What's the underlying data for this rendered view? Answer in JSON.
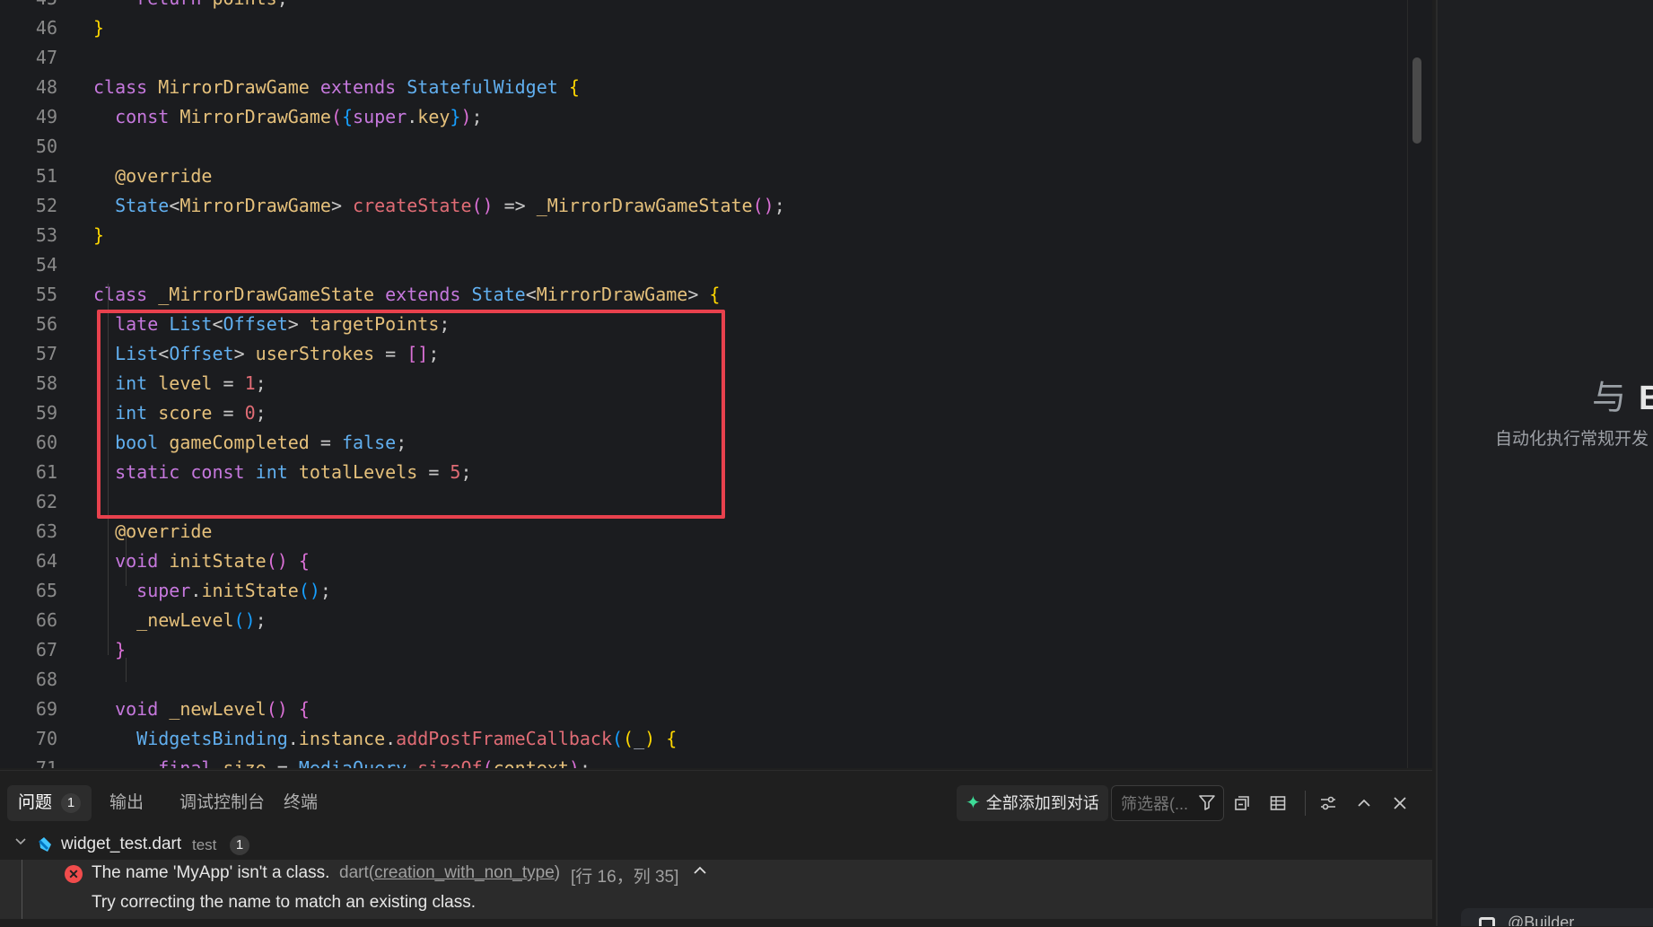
{
  "editor": {
    "lines": [
      {
        "n": "45",
        "t": "    return points;"
      },
      {
        "n": "46",
        "t": "}"
      },
      {
        "n": "47",
        "t": ""
      },
      {
        "n": "48",
        "t": "class MirrorDrawGame extends StatefulWidget {"
      },
      {
        "n": "49",
        "t": "  const MirrorDrawGame({super.key});"
      },
      {
        "n": "50",
        "t": ""
      },
      {
        "n": "51",
        "t": "  @override"
      },
      {
        "n": "52",
        "t": "  State<MirrorDrawGame> createState() => _MirrorDrawGameState();"
      },
      {
        "n": "53",
        "t": "}"
      },
      {
        "n": "54",
        "t": ""
      },
      {
        "n": "55",
        "t": "class _MirrorDrawGameState extends State<MirrorDrawGame> {"
      },
      {
        "n": "56",
        "t": "  late List<Offset> targetPoints;"
      },
      {
        "n": "57",
        "t": "  List<Offset> userStrokes = [];"
      },
      {
        "n": "58",
        "t": "  int level = 1;"
      },
      {
        "n": "59",
        "t": "  int score = 0;"
      },
      {
        "n": "60",
        "t": "  bool gameCompleted = false;"
      },
      {
        "n": "61",
        "t": "  static const int totalLevels = 5;"
      },
      {
        "n": "62",
        "t": ""
      },
      {
        "n": "63",
        "t": "  @override"
      },
      {
        "n": "64",
        "t": "  void initState() {"
      },
      {
        "n": "65",
        "t": "    super.initState();"
      },
      {
        "n": "66",
        "t": "    _newLevel();"
      },
      {
        "n": "67",
        "t": "  }"
      },
      {
        "n": "68",
        "t": ""
      },
      {
        "n": "69",
        "t": "  void _newLevel() {"
      },
      {
        "n": "70",
        "t": "    WidgetsBinding.instance.addPostFrameCallback((_) {"
      },
      {
        "n": "71",
        "t": "      final size = MediaQuery.sizeOf(context);"
      }
    ]
  },
  "side_panel": {
    "heading_glyph": "与",
    "heading": "B",
    "subtitle": "自动化执行常规开发",
    "footer_text": "@Builder"
  },
  "panel": {
    "tabs": [
      {
        "label": "问题",
        "count": "1"
      },
      {
        "label": "输出"
      },
      {
        "label": "调试控制台"
      },
      {
        "label": "终端"
      }
    ],
    "add_all_label": "全部添加到对话",
    "filter_placeholder": "筛选器(...",
    "file": {
      "name": "widget_test.dart",
      "dir": "test",
      "count": "1"
    },
    "error": {
      "message": "The name 'MyApp' isn't a class.",
      "source_prefix": "dart(",
      "source_code": "creation_with_non_type",
      "source_suffix": ")",
      "position": "[行 16，列 35]",
      "hint": "Try correcting the name to match an existing class."
    }
  },
  "colors": {
    "accent_error": "#f14c4c",
    "highlight_box": "#e8414d",
    "spark": "#3ddc97"
  }
}
